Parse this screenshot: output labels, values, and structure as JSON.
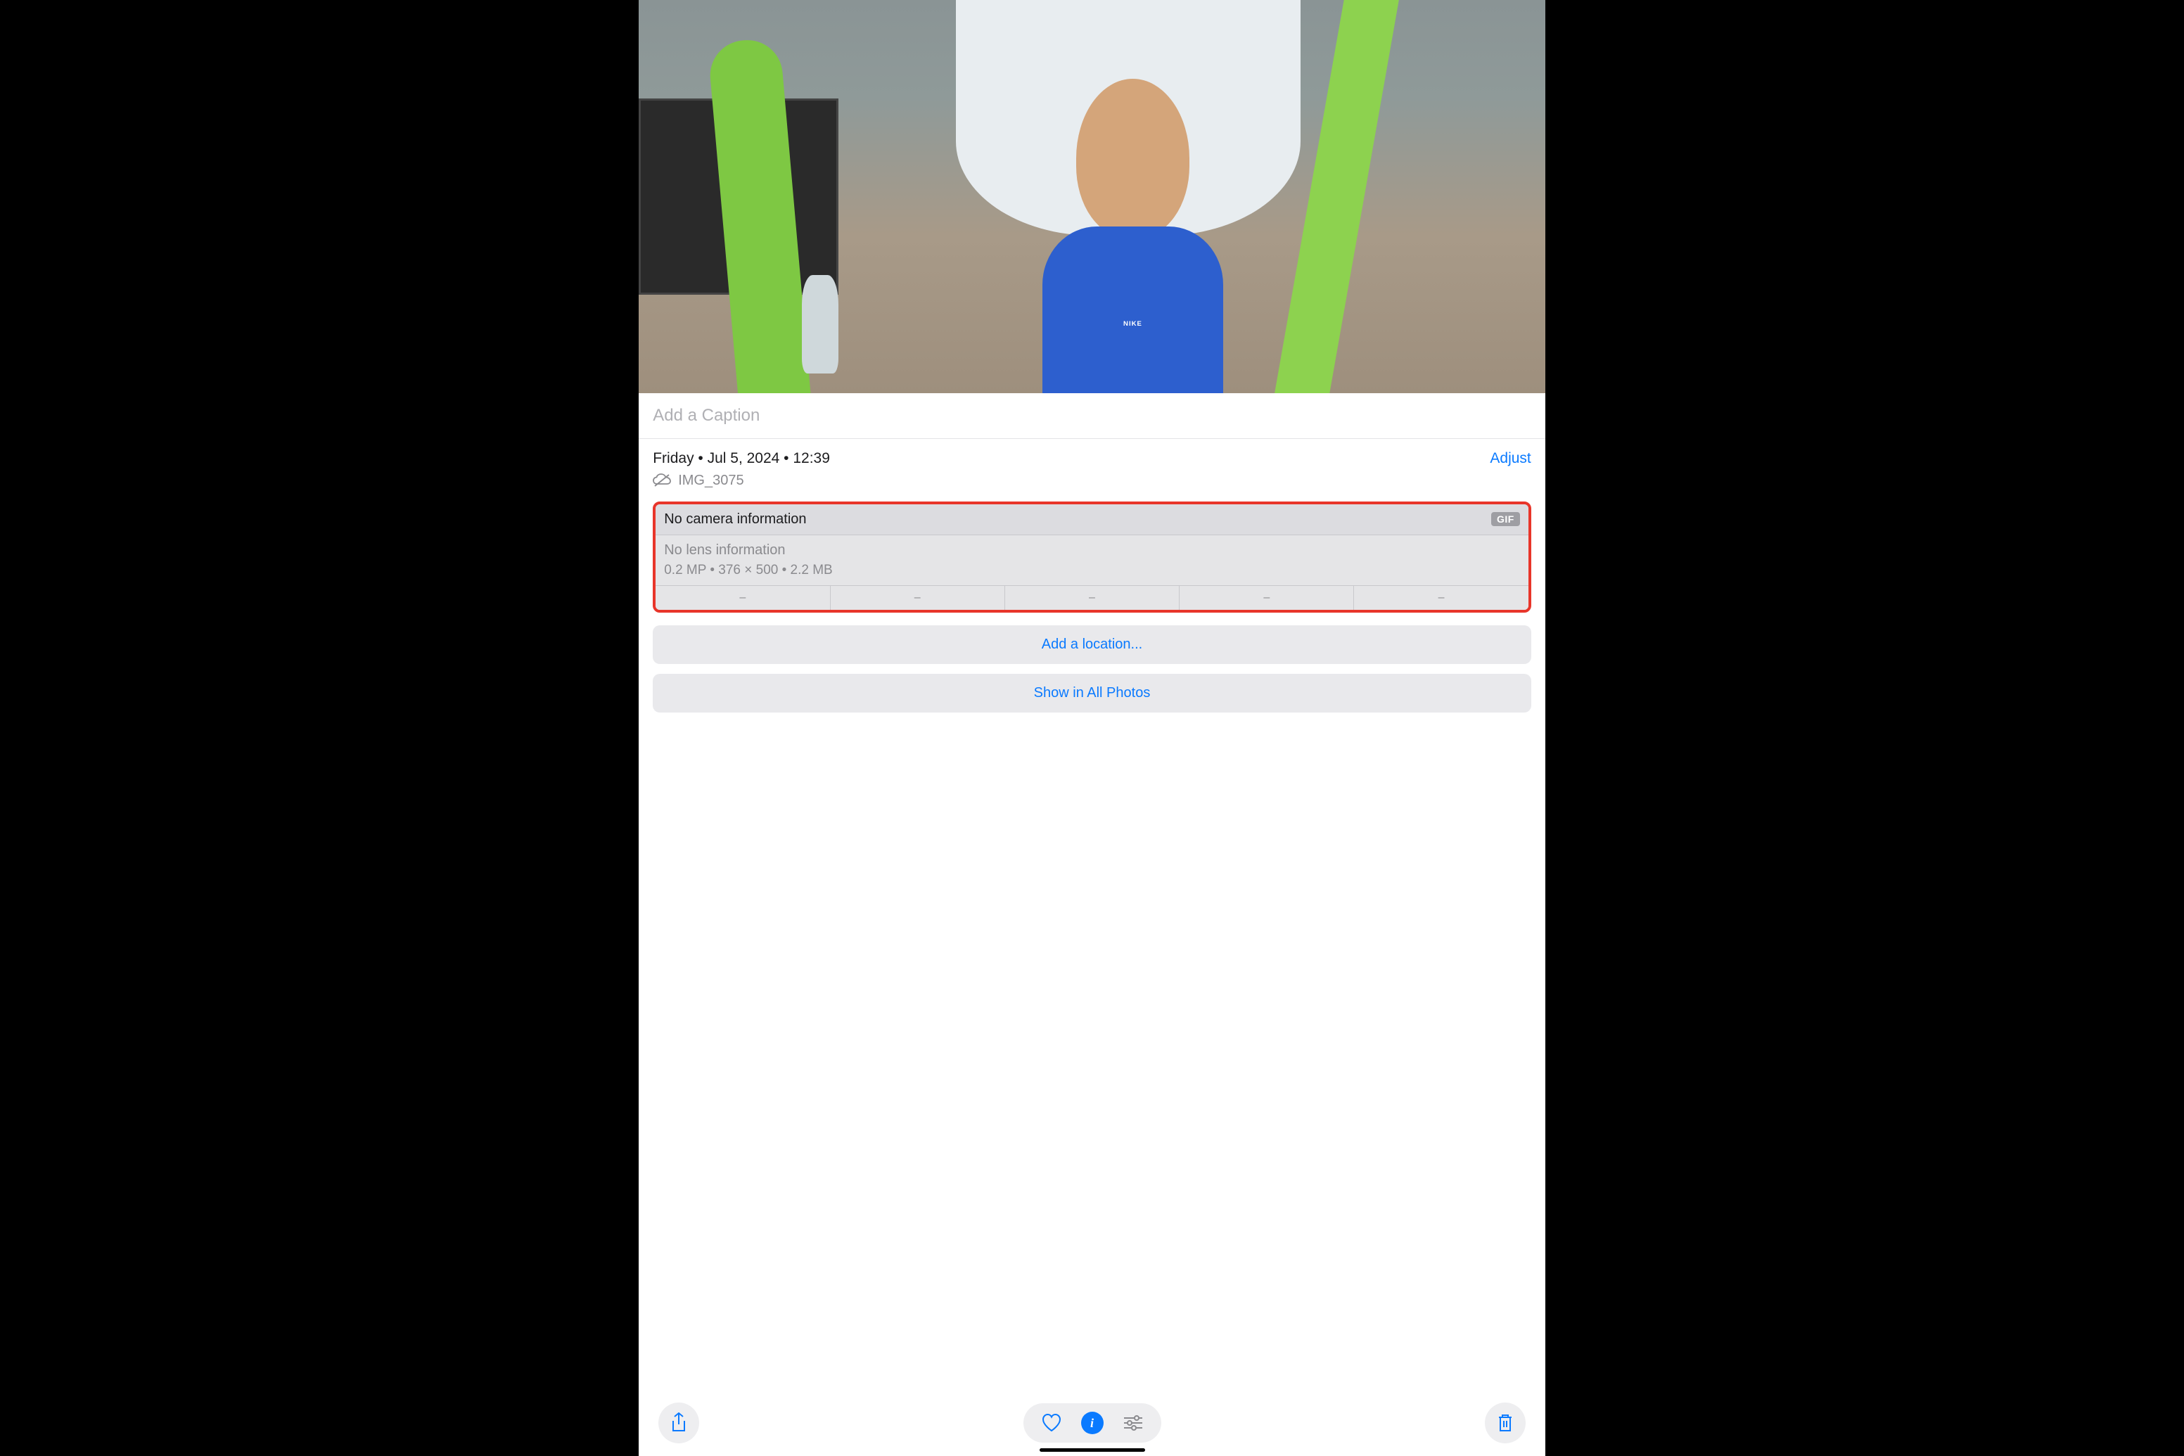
{
  "caption": {
    "placeholder": "Add a Caption"
  },
  "info": {
    "date_line": "Friday • Jul 5, 2024 • 12:39",
    "adjust_label": "Adjust",
    "filename": "IMG_3075"
  },
  "metadata": {
    "camera": "No camera information",
    "badge": "GIF",
    "lens": "No lens information",
    "specs": "0.2 MP  •  376 × 500  •  2.2 MB",
    "exif_cells": [
      "–",
      "–",
      "–",
      "–",
      "–"
    ]
  },
  "actions": {
    "add_location": "Add a location...",
    "show_all": "Show in All Photos"
  },
  "photo": {
    "shirt_text": "NIKE"
  },
  "colors": {
    "accent": "#0a7aff",
    "highlight_border": "#e8352a"
  }
}
